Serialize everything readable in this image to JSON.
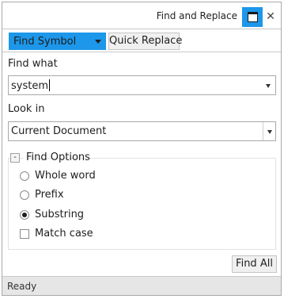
{
  "window": {
    "title": "Find and Replace"
  },
  "toolbar": {
    "mode_selected": "Find Symbol",
    "quick_replace_label": "Quick Replace",
    "accent_color": "#1c97ea"
  },
  "find_what": {
    "label": "Find what",
    "value": "system"
  },
  "look_in": {
    "label": "Look in",
    "value": "Current Document"
  },
  "options": {
    "header": "Find Options",
    "expander_glyph": "-",
    "whole_word": "Whole word",
    "prefix": "Prefix",
    "substring": "Substring",
    "match_case": "Match case",
    "selected": "Substring",
    "match_case_checked": false
  },
  "actions": {
    "find_all_label": "Find All"
  },
  "status": {
    "text": "Ready"
  },
  "icons": {
    "dock": "dock-window-icon",
    "close": "close-icon",
    "dropdown": "chevron-down-icon"
  }
}
